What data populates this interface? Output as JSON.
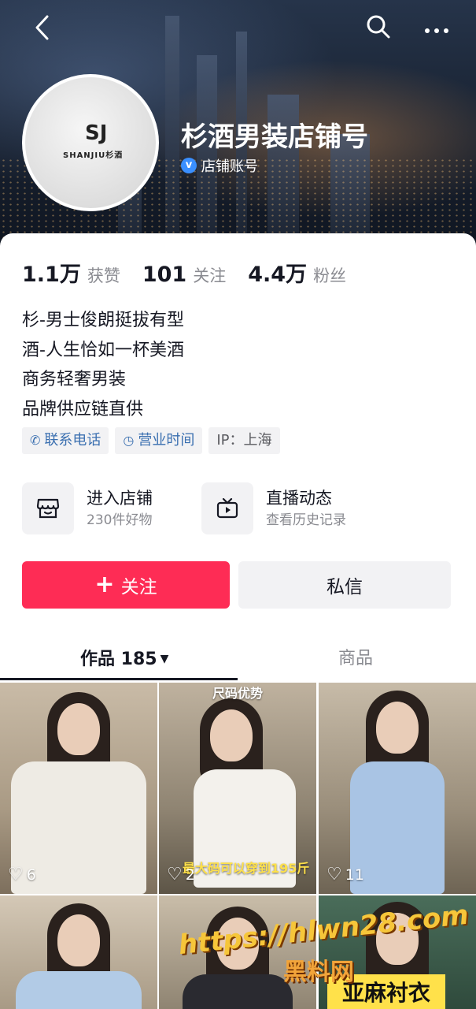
{
  "header": {
    "back_icon": "chevron-left-icon",
    "search_icon": "search-icon",
    "more_icon": "more-dots-icon"
  },
  "profile": {
    "logo_mark": "SJ",
    "logo_text": "SHANJIU杉酒",
    "name": "杉酒男装店铺号",
    "account_type": "店铺账号",
    "verified_icon": "v"
  },
  "stats": [
    {
      "value": "1.1万",
      "label": "获赞"
    },
    {
      "value": "101",
      "label": "关注"
    },
    {
      "value": "4.4万",
      "label": "粉丝"
    }
  ],
  "bio": [
    "杉-男士俊朗挺拔有型",
    "酒-人生恰如一杯美酒",
    "商务轻奢男装",
    "品牌供应链直供"
  ],
  "tags": [
    {
      "label": "联系电话",
      "icon": "phone-icon"
    },
    {
      "label": "营业时间",
      "icon": "clock-icon"
    },
    {
      "label": "IP：上海"
    }
  ],
  "entries": {
    "shop": {
      "title": "进入店铺",
      "subtitle": "230件好物",
      "icon": "store-icon"
    },
    "live": {
      "title": "直播动态",
      "subtitle": "查看历史记录",
      "icon": "tv-icon"
    }
  },
  "actions": {
    "follow": "关注",
    "message": "私信"
  },
  "tabs": {
    "works": "作品 185",
    "goods": "商品"
  },
  "grid": [
    {
      "likes": "6"
    },
    {
      "likes": "2",
      "overlay_title": "尺码优势",
      "overlay_caption": "最大码可以穿到195斤"
    },
    {
      "likes": "11"
    },
    {},
    {},
    {}
  ],
  "watermark": {
    "url": "https://hlwn28.com",
    "name": "黑料网",
    "banner": "亚麻衬衣"
  },
  "colors": {
    "accent": "#fe2c55",
    "tag_blue": "#3a6fb0"
  }
}
